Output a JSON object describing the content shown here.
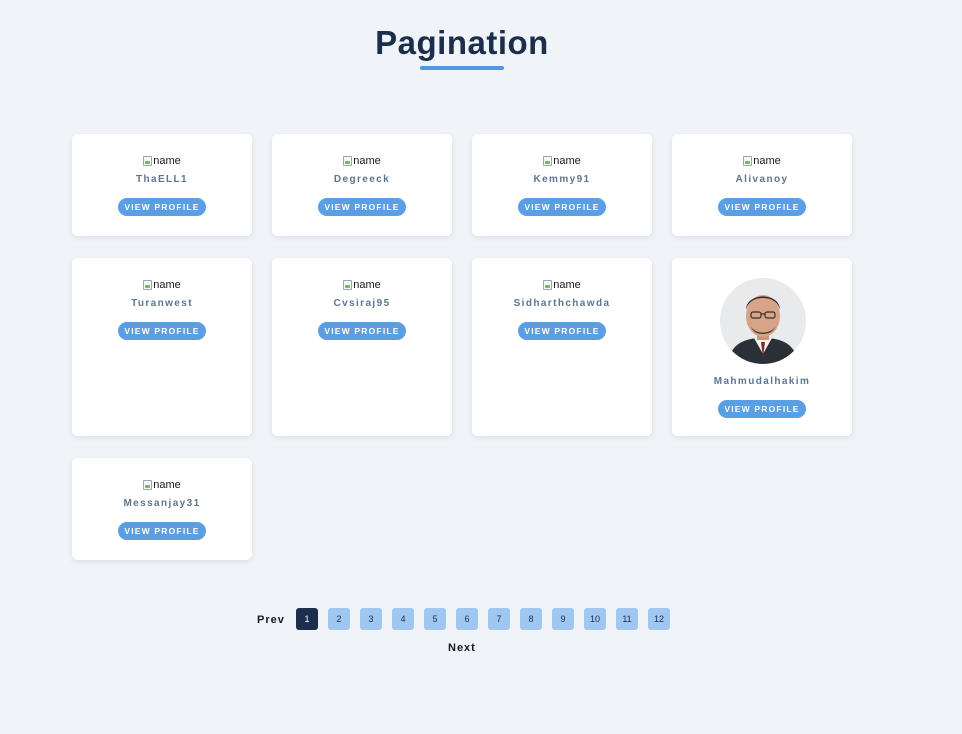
{
  "page": {
    "title": "Pagination"
  },
  "profiles": [
    {
      "username": "ThaELL1",
      "img_alt": "name",
      "button": "VIEW PROFILE"
    },
    {
      "username": "Degreeck",
      "img_alt": "name",
      "button": "VIEW PROFILE"
    },
    {
      "username": "Kemmy91",
      "img_alt": "name",
      "button": "VIEW PROFILE"
    },
    {
      "username": "Alivanoy",
      "img_alt": "name",
      "button": "VIEW PROFILE"
    },
    {
      "username": "Turanwest",
      "img_alt": "name",
      "button": "VIEW PROFILE"
    },
    {
      "username": "Cvsiraj95",
      "img_alt": "name",
      "button": "VIEW PROFILE"
    },
    {
      "username": "Sidharthchawda",
      "img_alt": "name",
      "button": "VIEW PROFILE"
    },
    {
      "username": "Mahmudalhakim",
      "img_alt": "name",
      "button": "VIEW PROFILE"
    },
    {
      "username": "Messanjay31",
      "img_alt": "name",
      "button": "VIEW PROFILE"
    }
  ],
  "pagination": {
    "prev_label": "Prev",
    "next_label": "Next",
    "pages": [
      "1",
      "2",
      "3",
      "4",
      "5",
      "6",
      "7",
      "8",
      "9",
      "10",
      "11",
      "12"
    ],
    "current_page": 1
  },
  "colors": {
    "background": "#f0f4f8",
    "title": "#1b2e4b",
    "accent": "#4f97e0",
    "button": "#5a9ee3",
    "page_active": "#1b2e4b",
    "page_inactive": "#9fc7f0"
  }
}
